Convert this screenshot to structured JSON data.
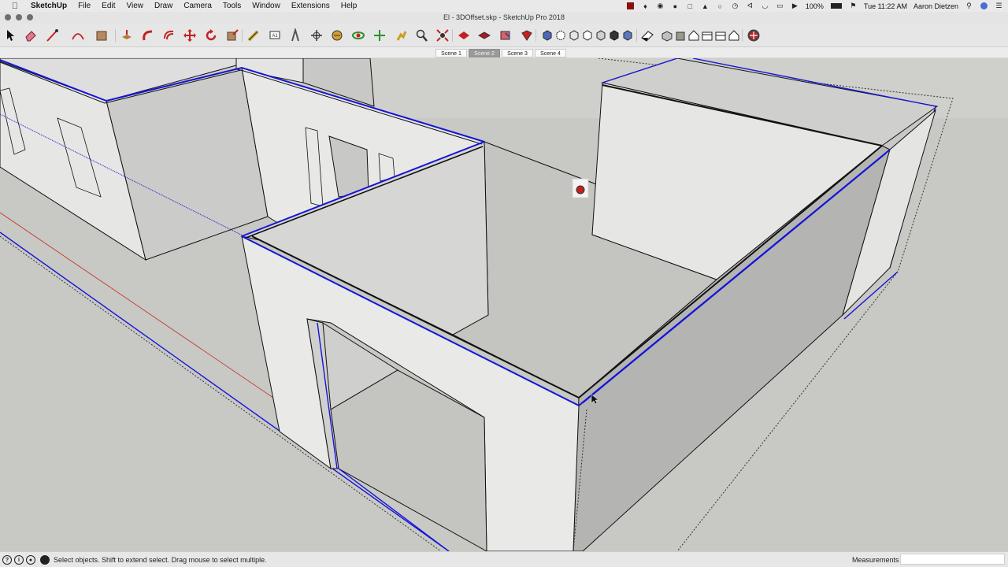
{
  "menubar": {
    "app_name": "SketchUp",
    "items": [
      "File",
      "Edit",
      "View",
      "Draw",
      "Camera",
      "Tools",
      "Window",
      "Extensions",
      "Help"
    ],
    "battery": "100%",
    "clock": "Tue 11:22 AM",
    "user": "Aaron Dietzen"
  },
  "window": {
    "title": "El - 3DOffset.skp - SketchUp Pro 2018"
  },
  "scenes": {
    "tabs": [
      "Scene 1",
      "Scene 2",
      "Scene 3",
      "Scene 4"
    ],
    "active": "Scene 2"
  },
  "toolbar": {
    "tools": [
      "select-tool",
      "eraser-tool",
      "line-tool",
      "arc-tool",
      "rectangle-tool",
      "push-pull-tool",
      "follow-me-tool",
      "offset-tool",
      "move-tool",
      "rotate-tool",
      "scale-tool",
      "tape-measure-tool",
      "text-tool",
      "axes-tool",
      "dimension-tool",
      "paint-bucket-tool",
      "orbit-tool",
      "pan-tool",
      "zoom-tool",
      "zoom-extents-tool",
      "previous-view-tool",
      "warehouse-tool",
      "extension-warehouse-tool",
      "send-to-layout-tool",
      "extension-manager-tool"
    ],
    "styles": [
      "xray-style",
      "backedges-style",
      "wireframe-style",
      "hidden-line-style",
      "shaded-style",
      "shaded-texture-style",
      "monochrome-style"
    ],
    "views": [
      "section-plane-tool",
      "iso-view",
      "top-view",
      "front-view",
      "right-view",
      "back-view",
      "left-view",
      "profile-button"
    ]
  },
  "statusbar": {
    "message": "Select objects. Shift to extend select. Drag mouse to select multiple.",
    "measurements_label": "Measurements",
    "measurements_value": ""
  },
  "colors": {
    "blue_axis": "#1515d8",
    "red_axis": "#c42a2a",
    "wall_light": "#e8e8e6",
    "ground": "#c8c8c4"
  }
}
